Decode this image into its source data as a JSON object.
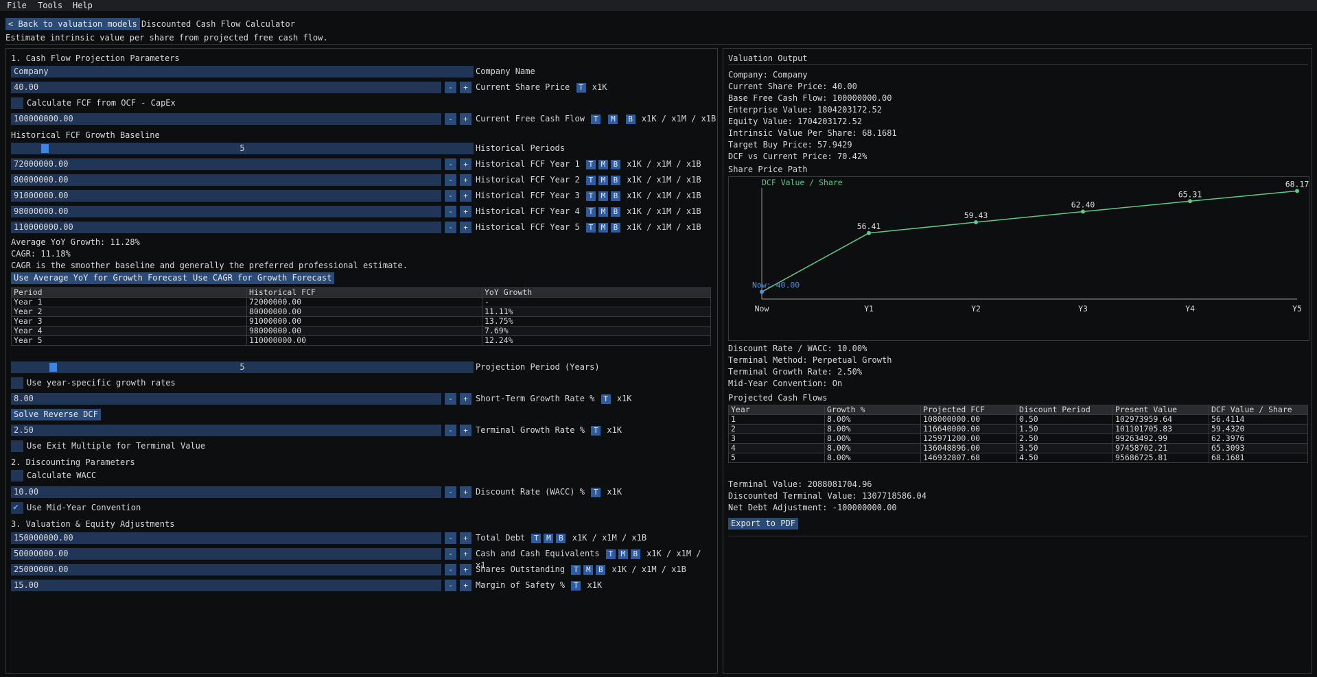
{
  "menu": {
    "file": "File",
    "tools": "Tools",
    "help": "Help"
  },
  "header": {
    "back_label": "< Back to valuation models",
    "title": "Discounted Cash Flow Calculator",
    "subtitle": "Estimate intrinsic value per share from projected free cash flow."
  },
  "tags": {
    "t": "T",
    "m": "M",
    "b": "B",
    "minus": "-",
    "plus": "+"
  },
  "left": {
    "section1": "1. Cash Flow Projection Parameters",
    "company_value": "Company",
    "company_label": "Company Name",
    "share_price_value": "40.00",
    "share_price_label": "Current Share Price",
    "suffix_k": "x1K",
    "suffix_kmb": "x1K / x1M / x1B",
    "calc_fcf_label": "Calculate FCF from OCF - CapEx",
    "fcf_value": "100000000.00",
    "fcf_label": "Current Free Cash Flow",
    "hist_heading": "Historical FCF Growth Baseline",
    "hist_periods_value": "5",
    "hist_periods_label": "Historical Periods",
    "hist_rows": [
      {
        "value": "72000000.00",
        "label": "Historical FCF Year 1"
      },
      {
        "value": "80000000.00",
        "label": "Historical FCF Year 2"
      },
      {
        "value": "91000000.00",
        "label": "Historical FCF Year 3"
      },
      {
        "value": "98000000.00",
        "label": "Historical FCF Year 4"
      },
      {
        "value": "110000000.00",
        "label": "Historical FCF Year 5"
      }
    ],
    "avg_yoy": "Average YoY Growth: 11.28%",
    "cagr": "CAGR: 11.18%",
    "cagr_note": "CAGR is the smoother baseline and generally the preferred professional estimate.",
    "use_avg_btn": "Use Average YoY for Growth Forecast",
    "use_cagr_btn": "Use CAGR for Growth Forecast",
    "hist_table": {
      "headers": [
        "Period",
        "Historical FCF",
        "YoY Growth"
      ],
      "rows": [
        [
          "Year 1",
          "72000000.00",
          "-"
        ],
        [
          "Year 2",
          "80000000.00",
          "11.11%"
        ],
        [
          "Year 3",
          "91000000.00",
          "13.75%"
        ],
        [
          "Year 4",
          "98000000.00",
          "7.69%"
        ],
        [
          "Year 5",
          "110000000.00",
          "12.24%"
        ]
      ]
    },
    "proj_period_value": "5",
    "proj_period_label": "Projection Period (Years)",
    "year_specific_label": "Use year-specific growth rates",
    "st_growth_value": "8.00",
    "st_growth_label": "Short-Term Growth Rate %",
    "solve_btn": "Solve Reverse DCF",
    "term_growth_value": "2.50",
    "term_growth_label": "Terminal Growth Rate %",
    "exit_multiple_label": "Use Exit Multiple for Terminal Value",
    "section2": "2. Discounting Parameters",
    "calc_wacc_label": "Calculate WACC",
    "wacc_value": "10.00",
    "wacc_label": "Discount Rate (WACC) %",
    "midyear_label": "Use Mid-Year Convention",
    "section3": "3. Valuation & Equity Adjustments",
    "debt_value": "150000000.00",
    "debt_label": "Total Debt",
    "cash_value": "50000000.00",
    "cash_label": "Cash and Cash Equivalents",
    "cash_suffix": "x1K / x1M / x1",
    "shares_value": "25000000.00",
    "shares_label": "Shares Outstanding",
    "mos_value": "15.00",
    "mos_label": "Margin of Safety %"
  },
  "right": {
    "title": "Valuation Output",
    "lines": [
      "Company: Company",
      "Current Share Price: 40.00",
      "Base Free Cash Flow: 100000000.00",
      "Enterprise Value: 1804203172.52",
      "Equity Value: 1704203172.52",
      "Intrinsic Value Per Share: 68.1681",
      "Target Buy Price: 57.9429",
      "DCF vs Current Price: 70.42%"
    ],
    "chart_heading": "Share Price Path",
    "lines2": [
      "Discount Rate / WACC: 10.00%",
      "Terminal Method: Perpetual Growth",
      "Terminal Growth Rate: 2.50%",
      "Mid-Year Convention: On"
    ],
    "proj_heading": "Projected Cash Flows",
    "proj_table": {
      "headers": [
        "Year",
        "Growth %",
        "Projected FCF",
        "Discount Period",
        "Present Value",
        "DCF Value / Share"
      ],
      "rows": [
        [
          "1",
          "8.00%",
          "108000000.00",
          "0.50",
          "102973959.64",
          "56.4114"
        ],
        [
          "2",
          "8.00%",
          "116640000.00",
          "1.50",
          "101101705.83",
          "59.4320"
        ],
        [
          "3",
          "8.00%",
          "125971200.00",
          "2.50",
          "99263492.99",
          "62.3976"
        ],
        [
          "4",
          "8.00%",
          "136048896.00",
          "3.50",
          "97458702.21",
          "65.3093"
        ],
        [
          "5",
          "8.00%",
          "146932807.68",
          "4.50",
          "95686725.81",
          "68.1681"
        ]
      ]
    },
    "lines3": [
      "Terminal Value: 2088081704.96",
      "Discounted Terminal Value: 1307718586.04",
      "Net Debt Adjustment: -100000000.00"
    ],
    "export_btn": "Export to PDF"
  },
  "chart_data": {
    "type": "line",
    "categories": [
      "Now",
      "Y1",
      "Y2",
      "Y3",
      "Y4",
      "Y5"
    ],
    "series": [
      {
        "name": "DCF Value / Share",
        "values": [
          40.0,
          56.41,
          59.43,
          62.4,
          65.31,
          68.17
        ]
      }
    ],
    "point_labels": [
      "Now: 40.00",
      "56.41",
      "59.43",
      "62.40",
      "65.31",
      "68.17"
    ],
    "colors": {
      "line": "#5ec98a",
      "now_point": "#4a8fe8",
      "axis": "#9a9a9a"
    }
  }
}
